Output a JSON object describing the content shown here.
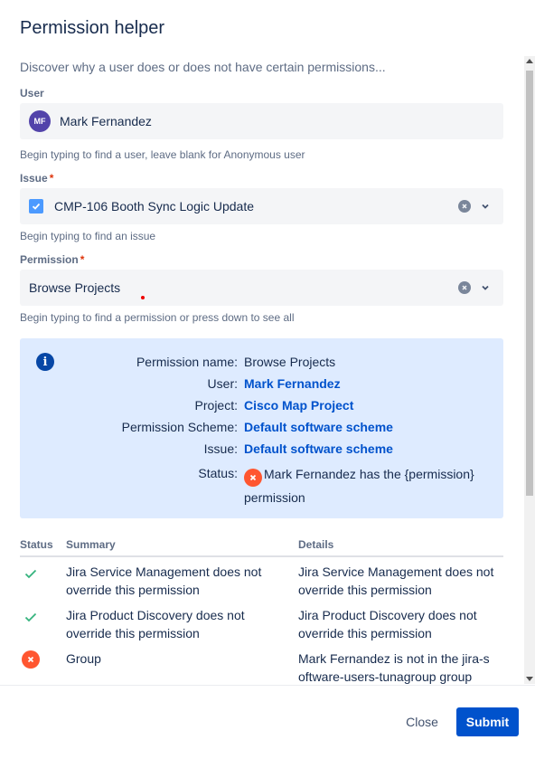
{
  "dialog": {
    "title": "Permission helper",
    "description": "Discover why a user does or does not have certain permissions..."
  },
  "user_field": {
    "label": "User",
    "avatar_initials": "MF",
    "value": "Mark Fernandez",
    "help": "Begin typing to find a user, leave blank for Anonymous user"
  },
  "issue_field": {
    "label": "Issue",
    "required_mark": "*",
    "value": "CMP-106 Booth Sync Logic Update",
    "help": "Begin typing to find an issue"
  },
  "permission_field": {
    "label": "Permission",
    "required_mark": "*",
    "value": "Browse Projects",
    "help": "Begin typing to find a permission or press down to see all"
  },
  "info": {
    "rows": [
      {
        "key": "Permission name:",
        "value": "Browse Projects"
      },
      {
        "key": "User:",
        "value": "Mark Fernandez"
      },
      {
        "key": "Project:",
        "value": "Cisco Map Project"
      },
      {
        "key": "Permission Scheme:",
        "value": "Default software scheme"
      },
      {
        "key": "Issue:",
        "value": "Default software scheme"
      }
    ],
    "status_key": "Status:",
    "status_value": "Mark Fernandez has the {permission} permission"
  },
  "table": {
    "headers": {
      "status": "Status",
      "summary": "Summary",
      "details": "Details"
    },
    "rows": [
      {
        "status": "success",
        "summary": "Jira Service Management does not override this permission",
        "details": "Jira Service Management does not override this permission"
      },
      {
        "status": "success",
        "summary": "Jira Product Discovery does not override this permission",
        "details": "Jira Product Discovery does not override this permission"
      },
      {
        "status": "error",
        "summary": "Group",
        "details": "Mark Fernandez is not in the jira-software-users-tunagroup group"
      }
    ]
  },
  "footer": {
    "close_label": "Close",
    "submit_label": "Submit"
  },
  "colors": {
    "accent": "#0052cc",
    "info_bg": "#deebff",
    "success": "#36b37e",
    "error": "#ff5630",
    "avatar": "#5243aa"
  }
}
